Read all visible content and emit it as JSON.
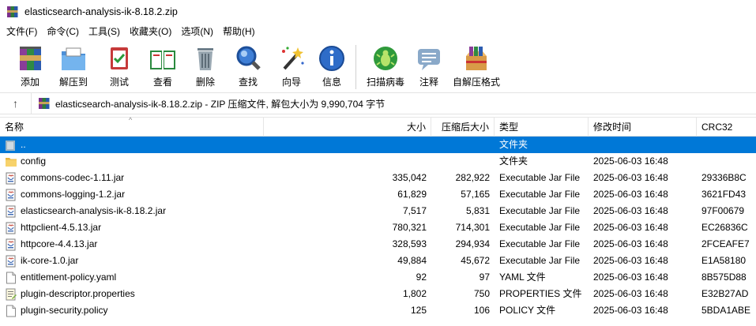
{
  "window": {
    "title": "elasticsearch-analysis-ik-8.18.2.zip"
  },
  "menu": [
    {
      "label": "文件(F)",
      "name": "menu-file"
    },
    {
      "label": "命令(C)",
      "name": "menu-commands"
    },
    {
      "label": "工具(S)",
      "name": "menu-tools"
    },
    {
      "label": "收藏夹(O)",
      "name": "menu-favorites"
    },
    {
      "label": "选项(N)",
      "name": "menu-options"
    },
    {
      "label": "帮助(H)",
      "name": "menu-help"
    }
  ],
  "toolbar": [
    {
      "label": "添加",
      "name": "add-button",
      "icon": "add-icon"
    },
    {
      "label": "解压到",
      "name": "extract-to-button",
      "icon": "extract-icon"
    },
    {
      "label": "测试",
      "name": "test-button",
      "icon": "test-icon"
    },
    {
      "label": "查看",
      "name": "view-button",
      "icon": "view-icon"
    },
    {
      "label": "删除",
      "name": "delete-button",
      "icon": "delete-icon"
    },
    {
      "label": "查找",
      "name": "find-button",
      "icon": "find-icon"
    },
    {
      "label": "向导",
      "name": "wizard-button",
      "icon": "wizard-icon"
    },
    {
      "label": "信息",
      "name": "info-button",
      "icon": "info-icon"
    },
    {
      "label": "扫描病毒",
      "name": "virus-scan-button",
      "icon": "virus-scan-icon"
    },
    {
      "label": "注释",
      "name": "comment-button",
      "icon": "comment-icon"
    },
    {
      "label": "自解压格式",
      "name": "sfx-button",
      "icon": "sfx-icon"
    }
  ],
  "address": {
    "up_label": "↑",
    "path": "elasticsearch-analysis-ik-8.18.2.zip - ZIP 压缩文件, 解包大小为 9,990,704 字节"
  },
  "columns": {
    "name": "名称",
    "size": "大小",
    "packed": "压缩后大小",
    "type": "类型",
    "modified": "修改时间",
    "crc": "CRC32"
  },
  "files": [
    {
      "name": "..",
      "size": "",
      "packed": "",
      "type": "文件夹",
      "modified": "",
      "crc": "",
      "icon": "parent-folder-icon",
      "selected": true
    },
    {
      "name": "config",
      "size": "",
      "packed": "",
      "type": "文件夹",
      "modified": "2025-06-03 16:48",
      "crc": "",
      "icon": "folder-icon"
    },
    {
      "name": "commons-codec-1.11.jar",
      "size": "335,042",
      "packed": "282,922",
      "type": "Executable Jar File",
      "modified": "2025-06-03 16:48",
      "crc": "29336B8C",
      "icon": "jar-icon"
    },
    {
      "name": "commons-logging-1.2.jar",
      "size": "61,829",
      "packed": "57,165",
      "type": "Executable Jar File",
      "modified": "2025-06-03 16:48",
      "crc": "3621FD43",
      "icon": "jar-icon"
    },
    {
      "name": "elasticsearch-analysis-ik-8.18.2.jar",
      "size": "7,517",
      "packed": "5,831",
      "type": "Executable Jar File",
      "modified": "2025-06-03 16:48",
      "crc": "97F00679",
      "icon": "jar-icon"
    },
    {
      "name": "httpclient-4.5.13.jar",
      "size": "780,321",
      "packed": "714,301",
      "type": "Executable Jar File",
      "modified": "2025-06-03 16:48",
      "crc": "EC26836C",
      "icon": "jar-icon"
    },
    {
      "name": "httpcore-4.4.13.jar",
      "size": "328,593",
      "packed": "294,934",
      "type": "Executable Jar File",
      "modified": "2025-06-03 16:48",
      "crc": "2FCEAFE7",
      "icon": "jar-icon"
    },
    {
      "name": "ik-core-1.0.jar",
      "size": "49,884",
      "packed": "45,672",
      "type": "Executable Jar File",
      "modified": "2025-06-03 16:48",
      "crc": "E1A58180",
      "icon": "jar-icon"
    },
    {
      "name": "entitlement-policy.yaml",
      "size": "92",
      "packed": "97",
      "type": "YAML 文件",
      "modified": "2025-06-03 16:48",
      "crc": "8B575D88",
      "icon": "file-icon"
    },
    {
      "name": "plugin-descriptor.properties",
      "size": "1,802",
      "packed": "750",
      "type": "PROPERTIES 文件",
      "modified": "2025-06-03 16:48",
      "crc": "E32B27AD",
      "icon": "properties-icon"
    },
    {
      "name": "plugin-security.policy",
      "size": "125",
      "packed": "106",
      "type": "POLICY 文件",
      "modified": "2025-06-03 16:48",
      "crc": "5BDA1ABE",
      "icon": "file-icon"
    }
  ],
  "colors": {
    "selection": "#0078d7",
    "folder": "#f4c24a"
  }
}
